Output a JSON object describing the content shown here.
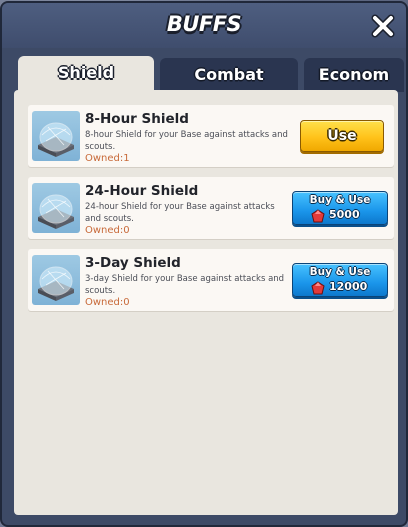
{
  "modal": {
    "title": "BUFFS",
    "close_icon": "close-icon"
  },
  "tabs": [
    {
      "label": "Shield",
      "active": true
    },
    {
      "label": "Combat",
      "active": false
    },
    {
      "label": "Econom",
      "active": false
    }
  ],
  "items": [
    {
      "title": "8-Hour Shield",
      "description": "8-hour Shield for your Base against attacks and scouts.",
      "owned": "Owned:1",
      "action_label": "Use",
      "icon": "shield-dome-icon"
    },
    {
      "title": "24-Hour Shield",
      "description": "24-hour Shield for your Base against attacks and scouts.",
      "owned": "Owned:0",
      "action_label": "Buy & Use",
      "price": "5000",
      "currency_icon": "gem-icon",
      "icon": "shield-dome-icon"
    },
    {
      "title": "3-Day Shield",
      "description": "3-day Shield for your Base against attacks and scouts.",
      "owned": "Owned:0",
      "action_label": "Buy & Use",
      "price": "12000",
      "currency_icon": "gem-icon",
      "icon": "shield-dome-icon"
    }
  ],
  "colors": {
    "use_button": "#ffc21a",
    "buy_button": "#1a95ea",
    "owned_text": "#c86a3a",
    "panel_bg": "#e9e6df",
    "modal_bg": "#3d4a66"
  }
}
